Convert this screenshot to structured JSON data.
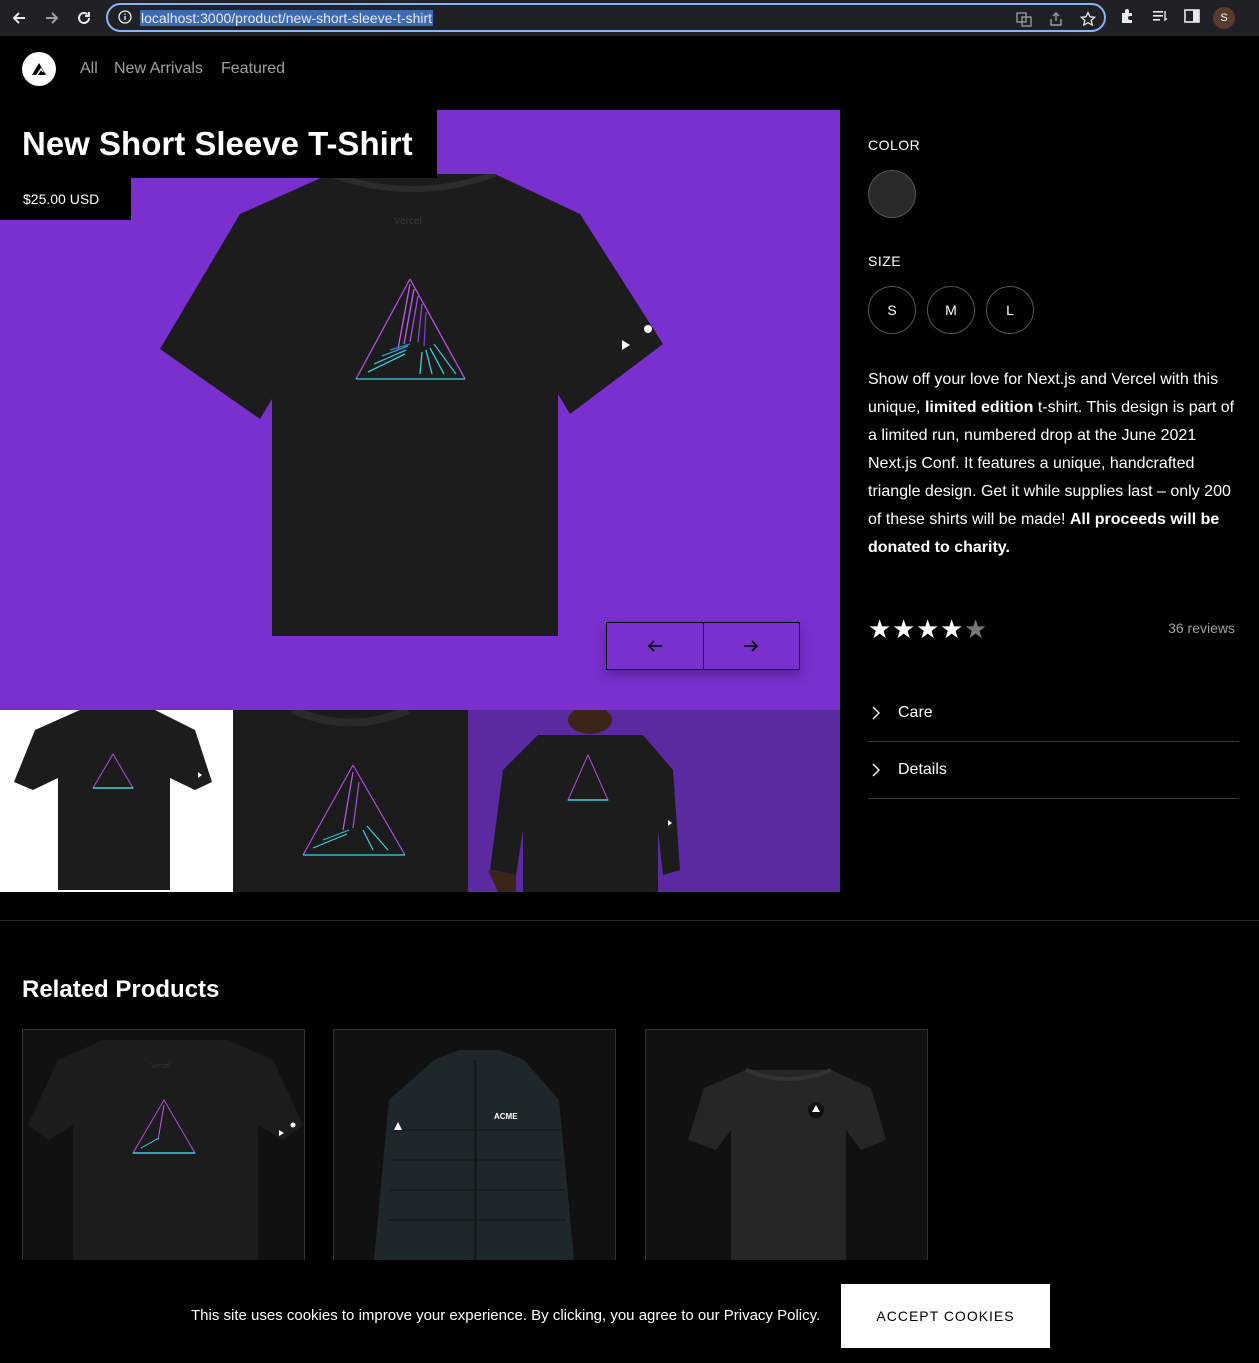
{
  "browser": {
    "url": "localhost:3000/product/new-short-sleeve-t-shirt",
    "avatar_letter": "S"
  },
  "nav": {
    "links": [
      "All",
      "New Arrivals",
      "Featured"
    ]
  },
  "product": {
    "title": "New Short Sleeve T-Shirt",
    "price": "$25.00 USD",
    "shirt_brand_print": "Vercel",
    "color_label": "COLOR",
    "size_label": "SIZE",
    "sizes": [
      "S",
      "M",
      "L"
    ],
    "description_parts": [
      {
        "text": "Show off your love for Next.js and Vercel with this unique, ",
        "bold": false
      },
      {
        "text": "limited edition",
        "bold": true
      },
      {
        "text": " t-shirt. This design is part of a limited run, numbered drop at the June 2021 Next.js Conf. It features a unique, handcrafted triangle design. Get it while supplies last – only 200 of these shirts will be made! ",
        "bold": false
      },
      {
        "text": "All proceeds will be donated to charity.",
        "bold": true
      }
    ],
    "rating": 4,
    "rating_max": 5,
    "reviews": "36 reviews",
    "sections": [
      "Care",
      "Details"
    ]
  },
  "related": {
    "title": "Related Products",
    "jacket_print": "ACME"
  },
  "cookie": {
    "text": "This site uses cookies to improve your experience. By clicking, you agree to our Privacy Policy.",
    "button": "ACCEPT COOKIES"
  },
  "colors": {
    "hero_bg": "#7a2fcf",
    "thumb_bg_white": "#ffffff",
    "thumb_bg_purple": "#5b2aa0",
    "url_focus": "#8ab4f8"
  }
}
